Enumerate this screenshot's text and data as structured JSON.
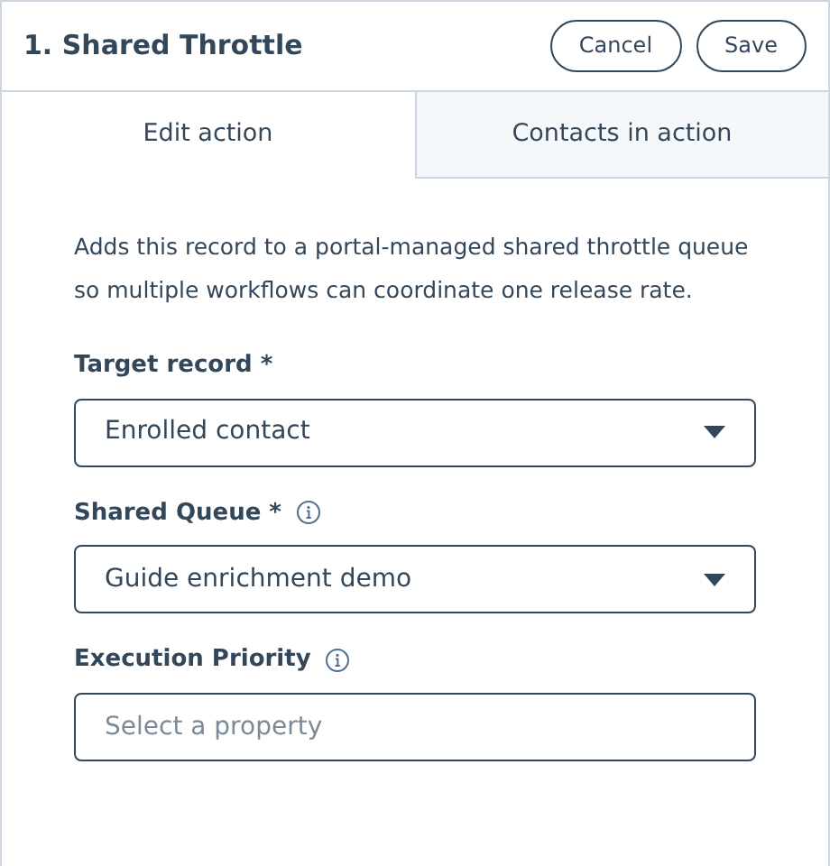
{
  "header": {
    "title": "1. Shared Throttle",
    "buttons": [
      "Cancel",
      "Save"
    ]
  },
  "tabs": [
    {
      "label": "Edit action",
      "selected": true
    },
    {
      "label": "Contacts in action",
      "selected": false
    }
  ],
  "description": "Adds this record to a portal-managed shared throttle queue so multiple workflows can coordinate one release rate.",
  "fields": [
    {
      "label": "Target record *",
      "info": false,
      "kind": "select",
      "value": "Enrolled contact"
    },
    {
      "label": "Shared Queue *",
      "info": true,
      "kind": "select",
      "value": "Guide enrichment demo"
    },
    {
      "label": "Execution Priority",
      "info": true,
      "kind": "input",
      "placeholder": "Select a property"
    }
  ]
}
